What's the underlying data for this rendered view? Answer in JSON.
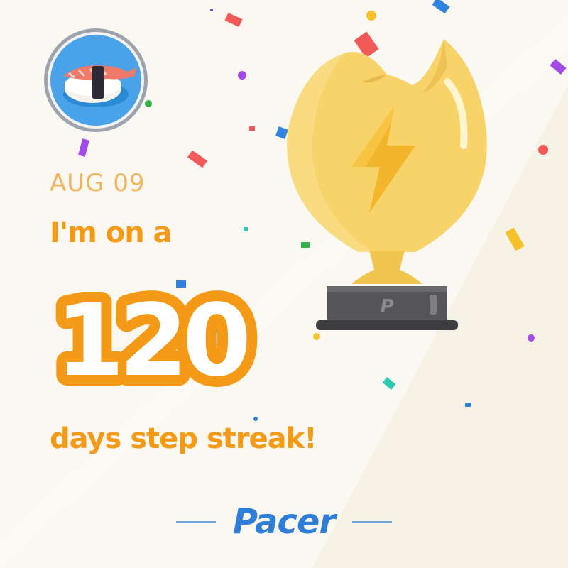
{
  "card": {
    "date": "AUG 09",
    "line1": "I'm on a",
    "streak_days": "120",
    "line2": "days step streak!",
    "brand": "Pacer",
    "trophy_badge": "P"
  },
  "colors": {
    "accent_orange": "#f59a16",
    "date_orange": "#f2b45f",
    "brand_blue": "#2f7ed8",
    "trophy_gold": "#f7d36a",
    "background": "#fbf8f1"
  },
  "icons": {
    "avatar": "sushi-avatar-icon",
    "trophy": "trophy-icon",
    "bolt": "lightning-bolt-icon"
  }
}
